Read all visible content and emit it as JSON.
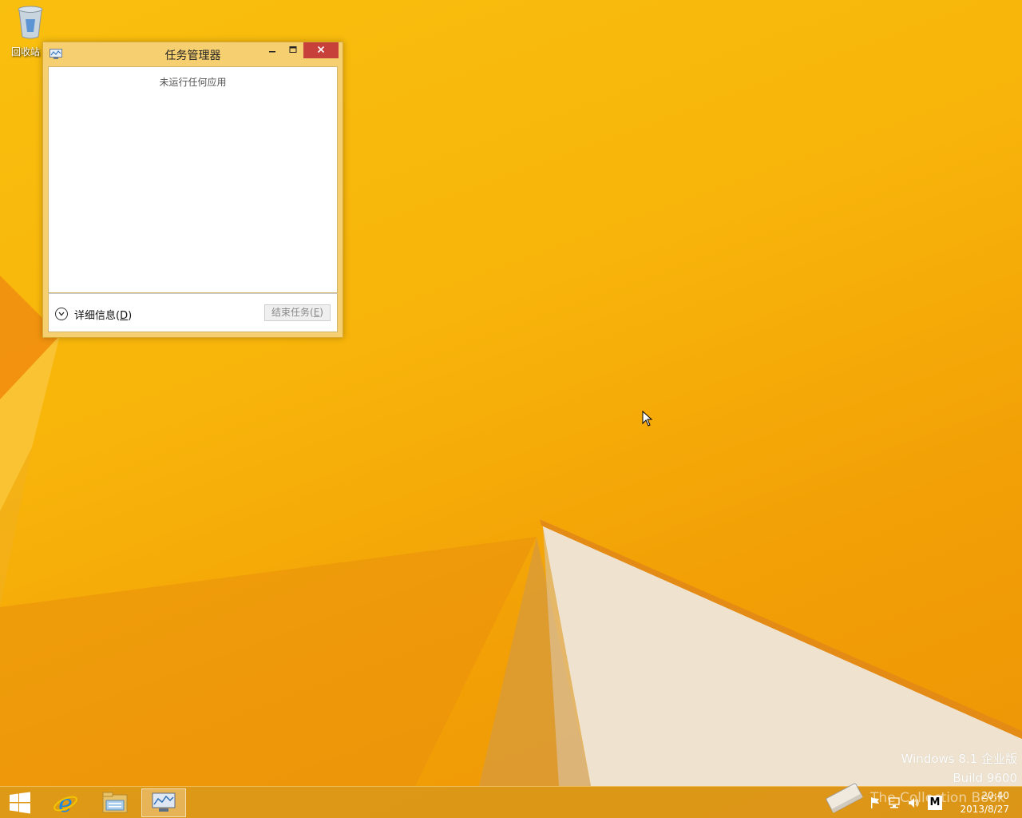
{
  "desktop": {
    "recycle_bin_label": "回收站"
  },
  "task_manager": {
    "title": "任务管理器",
    "empty_message": "未运行任何应用",
    "details_label": "详细信息",
    "details_accesskey": "D",
    "end_task_label": "结束任务",
    "end_task_accesskey": "E",
    "window_buttons": {
      "minimize_icon": "minimize-icon",
      "maximize_icon": "maximize-icon",
      "close_icon": "close-icon"
    }
  },
  "watermark": {
    "line1": "Windows 8.1 企业版",
    "line2": "Build 9600"
  },
  "taskbar": {
    "pinned": [
      "start-icon",
      "internet-explorer-icon",
      "file-explorer-icon",
      "task-manager-icon"
    ],
    "tray_overlay_text": "The Collection Book",
    "ime_label": "M",
    "clock_time": "20:40",
    "clock_date": "2013/8/27"
  },
  "colors": {
    "desktop_accent": "#f9bf0e",
    "window_frame": "#f6cf70",
    "close_button": "#c7403a"
  }
}
